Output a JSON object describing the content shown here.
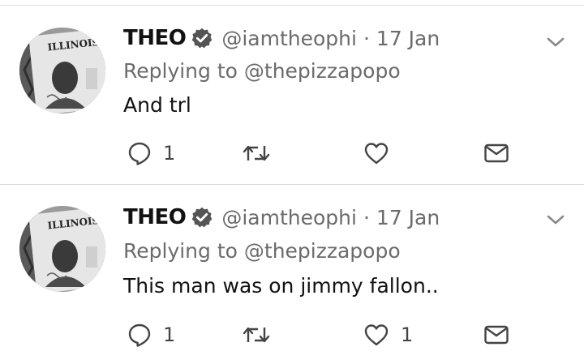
{
  "colors": {
    "text": "#111111",
    "secondary": "#6b6b6b",
    "divider": "#d9d9d9",
    "icon": "#444444"
  },
  "tweets": [
    {
      "display_name": "THEO",
      "verified_icon": "verified-badge-icon",
      "handle": "@iamtheophi",
      "separator": "·",
      "date": "17 Jan",
      "replying_to": "Replying to @thepizzapopo",
      "text": "And trl",
      "avatar_card_text": "ILLINOIS",
      "actions": {
        "reply_count": "1",
        "retweet_count": "",
        "like_count": ""
      }
    },
    {
      "display_name": "THEO",
      "verified_icon": "verified-badge-icon",
      "handle": "@iamtheophi",
      "separator": "·",
      "date": "17 Jan",
      "replying_to": "Replying to @thepizzapopo",
      "text": "This man was on jimmy fallon..",
      "avatar_card_text": "ILLINOIS",
      "actions": {
        "reply_count": "1",
        "retweet_count": "",
        "like_count": "1"
      }
    }
  ]
}
